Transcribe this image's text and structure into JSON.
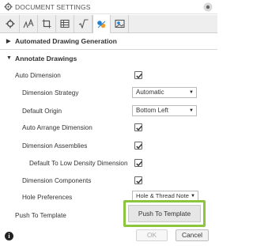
{
  "window": {
    "title": "DOCUMENT SETTINGS"
  },
  "tabs": [
    {
      "icon": "gear-icon"
    },
    {
      "icon": "text-style-icon"
    },
    {
      "icon": "frame-icon"
    },
    {
      "icon": "table-icon"
    },
    {
      "icon": "square-root-icon"
    },
    {
      "icon": "annotate-icon",
      "active": true
    },
    {
      "icon": "image-settings-icon"
    }
  ],
  "sections": {
    "automated_label": "Automated Drawing Generation",
    "annotate_label": "Annotate Drawings"
  },
  "settings": {
    "auto_dimension": "Auto Dimension",
    "dimension_strategy": "Dimension Strategy",
    "dimension_strategy_value": "Automatic",
    "default_origin": "Default Origin",
    "default_origin_value": "Bottom Left",
    "auto_arrange": "Auto Arrange Dimension",
    "dimension_assemblies": "Dimension Assemblies",
    "low_density": "Default To Low Density Dimension",
    "dimension_components": "Dimension Components",
    "hole_preferences": "Hole Preferences",
    "hole_preferences_value": "Hole & Thread Note",
    "push_to_template": "Push To Template"
  },
  "buttons": {
    "push_to_template": "Push To Template",
    "ok": "OK",
    "cancel": "Cancel"
  },
  "colors": {
    "highlight": "#8cc63f",
    "active_tab_icon": "#1f7fd1"
  }
}
